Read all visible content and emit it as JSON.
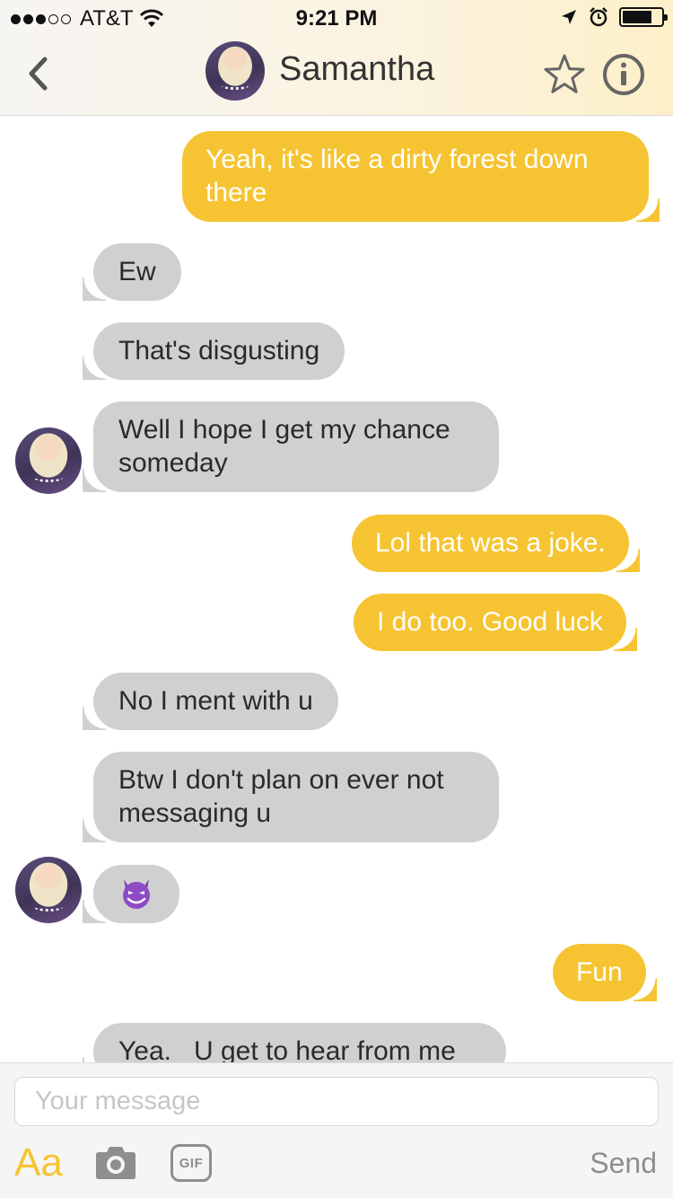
{
  "status_bar": {
    "carrier": "AT&T",
    "time": "9:21 PM",
    "signal_bars_filled": 3,
    "signal_bars_total": 5,
    "battery_level": 0.65
  },
  "header": {
    "contact_name": "Samantha",
    "back_icon": "chevron-left-icon",
    "favorite_icon": "star-outline-icon",
    "info_icon": "info-circle-icon"
  },
  "messages": [
    {
      "direction": "out",
      "text_lines": [
        "Yeah, it's like a dirty forest down",
        "there"
      ]
    },
    {
      "direction": "in",
      "text_lines": [
        "Ew"
      ]
    },
    {
      "direction": "in",
      "text_lines": [
        "That's disgusting"
      ]
    },
    {
      "direction": "in",
      "text_lines": [
        "Well I hope I get my chance",
        "someday"
      ],
      "avatar": true
    },
    {
      "direction": "out",
      "text_lines": [
        "Lol that was a joke."
      ]
    },
    {
      "direction": "out",
      "text_lines": [
        "I do too. Good luck"
      ]
    },
    {
      "direction": "in",
      "text_lines": [
        "No I ment with u"
      ]
    },
    {
      "direction": "in",
      "text_lines": [
        "Btw I don't plan on ever not",
        "messaging u"
      ]
    },
    {
      "direction": "in",
      "emoji": "smiling-devil-emoji",
      "avatar": true
    },
    {
      "direction": "out",
      "text_lines": [
        "Fun"
      ]
    },
    {
      "direction": "in",
      "text_lines": [
        "Yea.   U get to hear from me"
      ],
      "partially_visible": true
    }
  ],
  "composer": {
    "placeholder": "Your message",
    "format_label": "Aa",
    "camera_icon": "camera-icon",
    "gif_label": "GIF",
    "send_label": "Send"
  },
  "colors": {
    "outgoing_bubble": "#f6c432",
    "incoming_bubble": "#d0d0d0",
    "accent": "#f6c432",
    "muted_icon": "#8e8e8e"
  }
}
